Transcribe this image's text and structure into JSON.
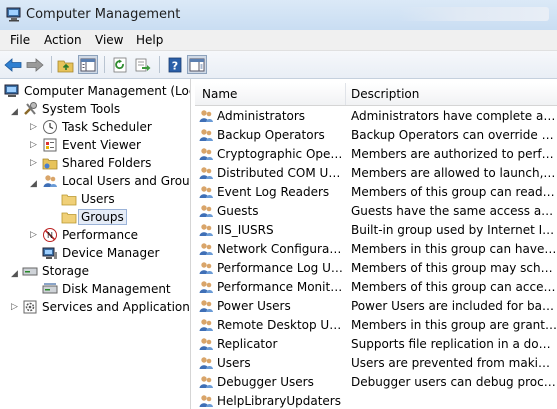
{
  "window": {
    "title": "Computer Management"
  },
  "menu": {
    "file": "File",
    "action": "Action",
    "view": "View",
    "help": "Help"
  },
  "toolbar": {
    "icons": [
      "back-arrow-icon",
      "forward-arrow-icon",
      "up-folder-icon",
      "show-hide-tree-icon",
      "refresh-icon",
      "export-list-icon",
      "help-icon",
      "properties-pane-icon"
    ]
  },
  "tree": {
    "root": "Computer Management (Local",
    "system_tools": "System Tools",
    "task_scheduler": "Task Scheduler",
    "event_viewer": "Event Viewer",
    "shared_folders": "Shared Folders",
    "local_users_groups": "Local Users and Groups",
    "users": "Users",
    "groups": "Groups",
    "performance": "Performance",
    "device_manager": "Device Manager",
    "storage": "Storage",
    "disk_management": "Disk Management",
    "services_apps": "Services and Applications"
  },
  "list": {
    "columns": {
      "name": "Name",
      "description": "Description"
    },
    "rows": [
      {
        "name": "Administrators",
        "description": "Administrators have complete an..."
      },
      {
        "name": "Backup Operators",
        "description": "Backup Operators can override se..."
      },
      {
        "name": "Cryptographic Operat...",
        "description": "Members are authorized to perfor..."
      },
      {
        "name": "Distributed COM Users",
        "description": "Members are allowed to launch, a..."
      },
      {
        "name": "Event Log Readers",
        "description": "Members of this group can read e..."
      },
      {
        "name": "Guests",
        "description": "Guests have the same access as m..."
      },
      {
        "name": "IIS_IUSRS",
        "description": "Built-in group used by Internet Inf..."
      },
      {
        "name": "Network Configuratio...",
        "description": "Members in this group can have s..."
      },
      {
        "name": "Performance Log Users",
        "description": "Members of this group may sche..."
      },
      {
        "name": "Performance Monitor ...",
        "description": "Members of this group can acces..."
      },
      {
        "name": "Power Users",
        "description": "Power Users are included for back..."
      },
      {
        "name": "Remote Desktop Users",
        "description": "Members in this group are grante..."
      },
      {
        "name": "Replicator",
        "description": "Supports file replication in a dom..."
      },
      {
        "name": "Users",
        "description": "Users are prevented from making ..."
      },
      {
        "name": "Debugger Users",
        "description": "Debugger users can debug proces..."
      },
      {
        "name": "HelpLibraryUpdaters",
        "description": ""
      }
    ]
  }
}
